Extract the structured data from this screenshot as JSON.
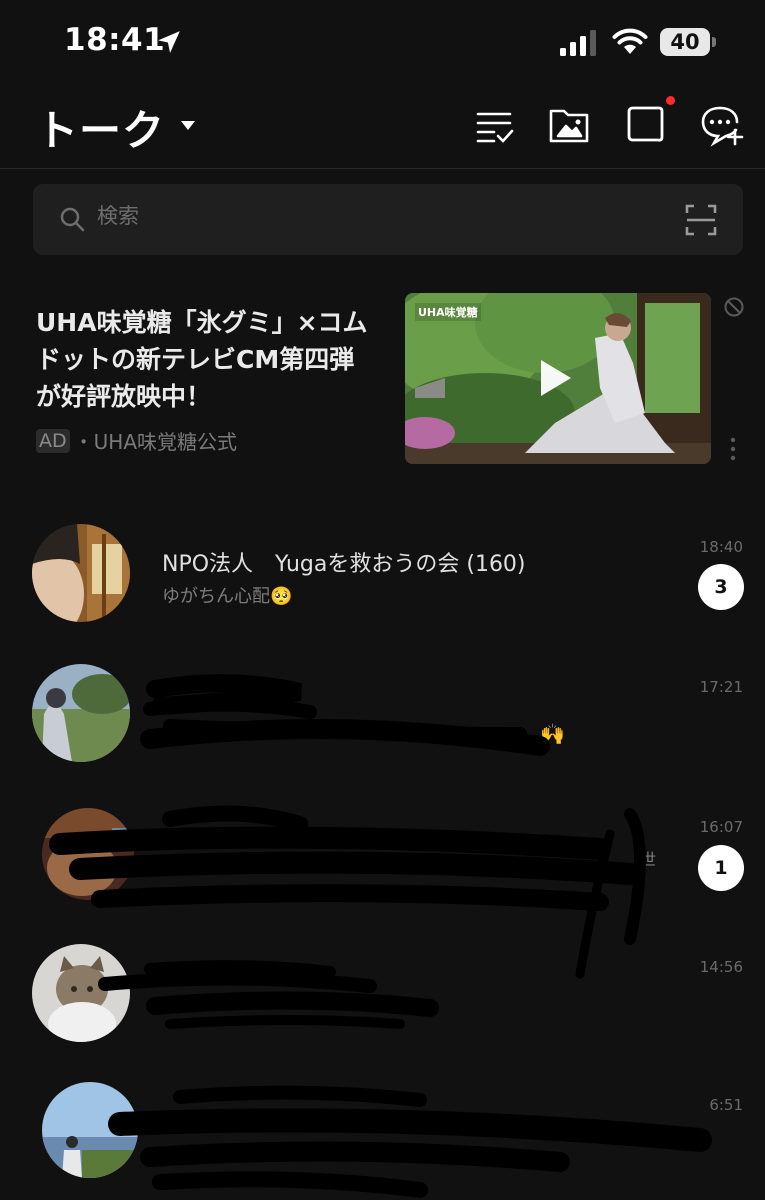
{
  "status_bar": {
    "time": "18:41",
    "battery": "40"
  },
  "header": {
    "title": "トーク",
    "icons": [
      "checklist-icon",
      "photo-folder-icon",
      "chat-bubble-icon",
      "new-chat-icon"
    ]
  },
  "search": {
    "placeholder": "検索"
  },
  "ad": {
    "title": "UHA味覚糖「氷グミ」×コムドットの新テレビCM第四弾が好評放映中！",
    "badge": "AD",
    "sponsor": "・UHA味覚糖公式",
    "thumb_logo": "UHA味覚糖"
  },
  "chats": [
    {
      "name": "NPO法人　Yugaを救おうの会",
      "count": "(160)",
      "preview": "ゆがちん心配🥺",
      "time": "18:40",
      "unread": "3"
    },
    {
      "preview_emoji": "🙌",
      "time": "17:21"
    },
    {
      "preview_partial": "世",
      "time": "16:07",
      "unread": "1"
    },
    {
      "time": "14:56"
    },
    {
      "time": "6:51"
    }
  ],
  "colors": {
    "background": "#111111",
    "search_bg": "#1f1f1f",
    "red_dot": "#ff2b2b"
  }
}
